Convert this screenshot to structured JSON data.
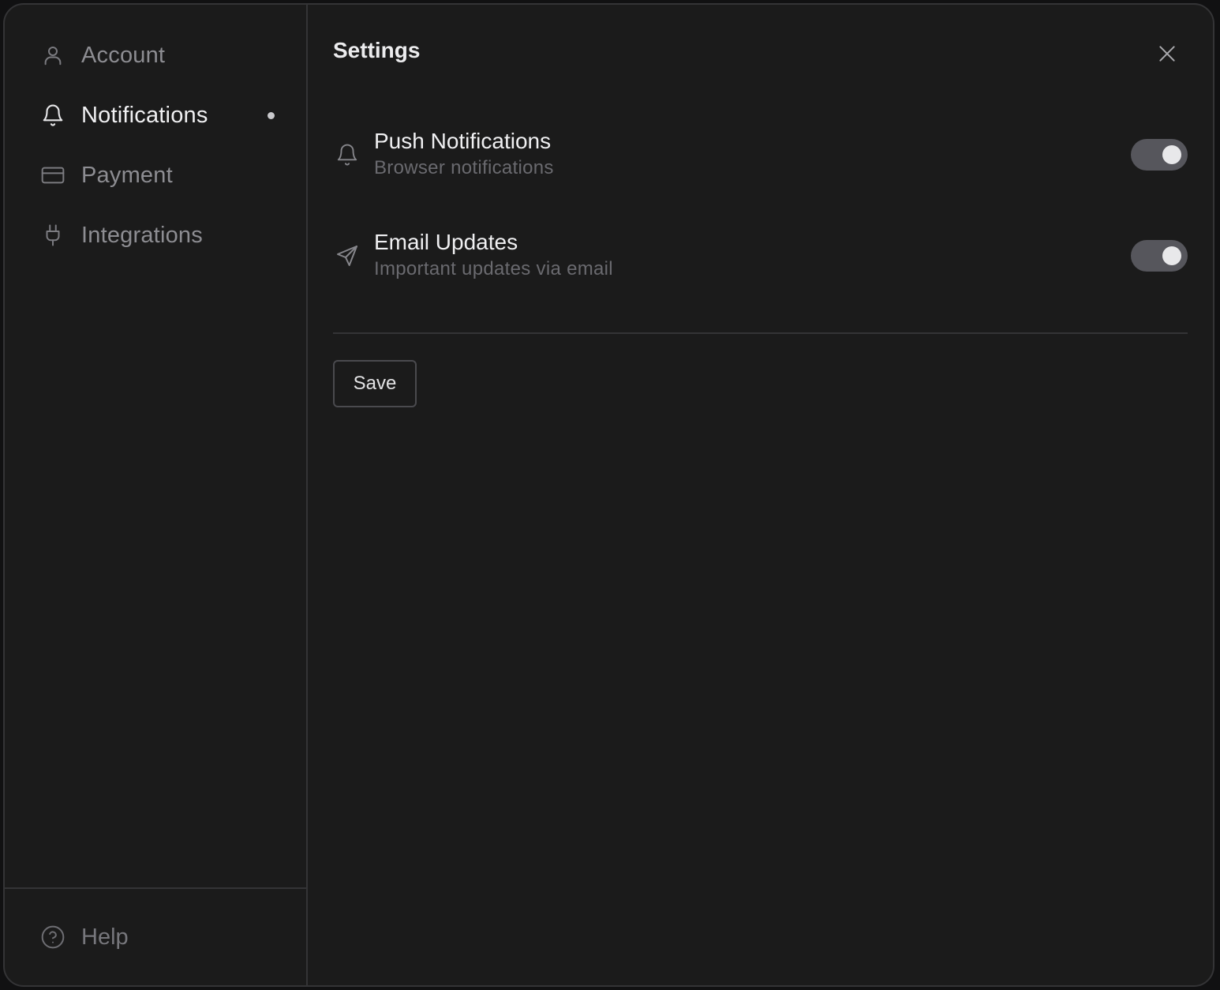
{
  "sidebar": {
    "items": [
      {
        "label": "Account",
        "icon": "user-icon",
        "active": false
      },
      {
        "label": "Notifications",
        "icon": "bell-icon",
        "active": true
      },
      {
        "label": "Payment",
        "icon": "credit-card-icon",
        "active": false
      },
      {
        "label": "Integrations",
        "icon": "plug-icon",
        "active": false
      }
    ],
    "footer": {
      "label": "Help",
      "icon": "help-circle-icon"
    }
  },
  "main": {
    "title": "Settings",
    "close_icon": "close-icon",
    "settings": [
      {
        "title": "Push Notifications",
        "subtitle": "Browser notifications",
        "icon": "bell-icon",
        "enabled": true
      },
      {
        "title": "Email Updates",
        "subtitle": "Important updates via email",
        "icon": "send-icon",
        "enabled": true
      }
    ],
    "save_label": "Save"
  },
  "colors": {
    "dialog_bg": "#1b1b1b",
    "border": "#343436",
    "text_primary": "#f0f0f2",
    "text_muted": "#8d8d92",
    "toggle_track": "#56565c",
    "toggle_knob": "#e8e8ea"
  }
}
